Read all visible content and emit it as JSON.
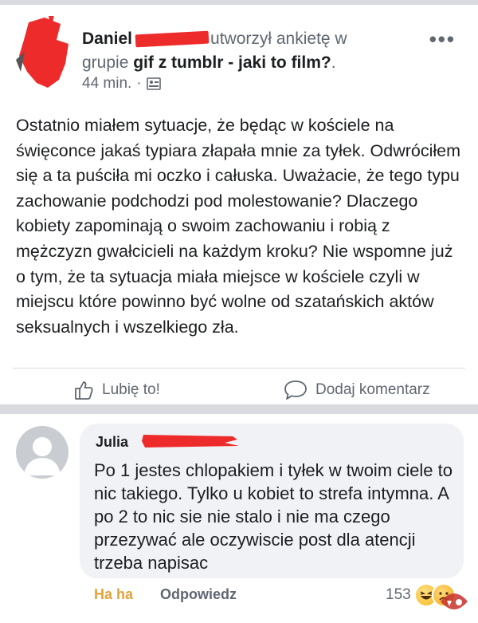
{
  "post": {
    "author_name": "Daniel",
    "header_action": "utworzył ankietę w",
    "header_group_prefix": "grupie",
    "group_name": "gif z tumblr - jaki to film?",
    "header_suffix": ".",
    "time": "44 min.",
    "dot": "·",
    "more_icon": "more-options-icon",
    "privacy_icon": "group-privacy-icon",
    "body": "Ostatnio miałem sytuacje, że będąc w kościele na święconce jakaś typiara złapała mnie za tyłek. Odwróciłem się a ta puściła mi oczko i całuska. Uważacie, że tego typu zachowanie podchodzi pod molestowanie? Dlaczego kobiety zapominają o swoim zachowaniu i robią z mężczyzn gwałcicieli na każdym kroku? Nie wspomne już o tym, że ta sytuacja miała miejsce w kościele czyli w miejscu które powinno być wolne od szatańskich aktów seksualnych i wszelkiego zła.",
    "like_label": "Lubię to!",
    "comment_label": "Dodaj komentarz"
  },
  "comment": {
    "author_name": "Julia",
    "text": "Po 1 jestes chlopakiem i tyłek w twoim ciele to nic takiego. Tylko u kobiet to strefa intymna. A po 2 to nic sie nie stalo i nie ma czego przezywać ale oczywiscie post dla atencji trzeba napisac",
    "reaction_label": "Ha ha",
    "reply_label": "Odpowiedz",
    "reaction_count": "153"
  },
  "colors": {
    "redaction": "#ee2b2b",
    "haha": "#e2a23b",
    "secondary_text": "#606770",
    "bubble": "#f0f2f5"
  }
}
